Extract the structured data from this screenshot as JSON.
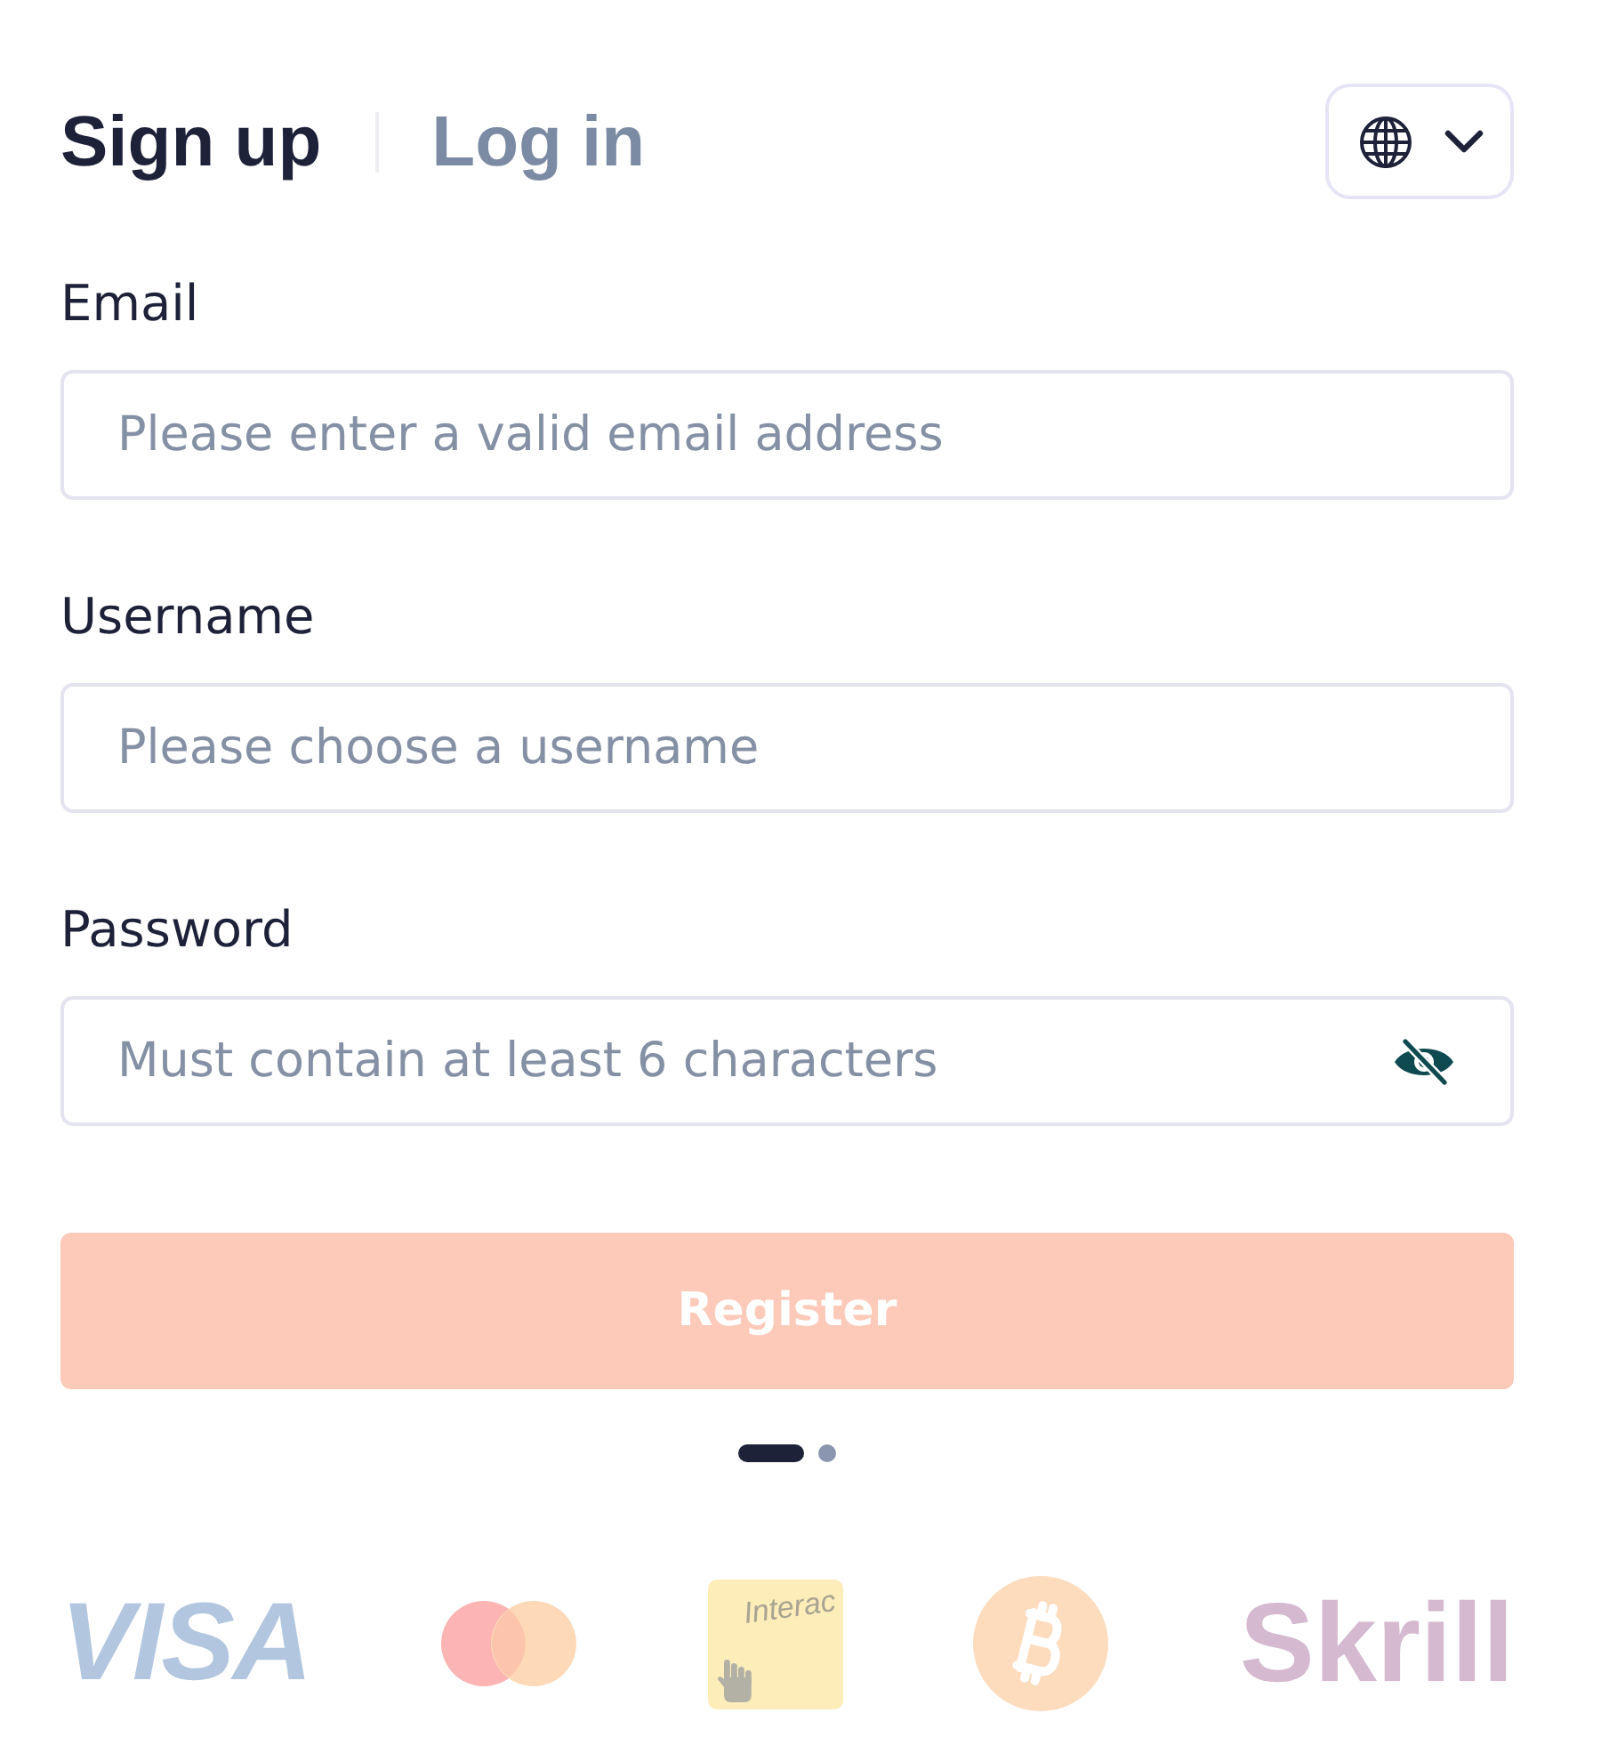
{
  "tabs": [
    {
      "label": "Sign up",
      "selected": true
    },
    {
      "label": "Log in",
      "selected": false
    }
  ],
  "language_menu": {
    "expanded": false
  },
  "fields": [
    {
      "kind": "email",
      "label": "Email",
      "placeholder": "Please enter a valid email address"
    },
    {
      "kind": "text",
      "label": "Username",
      "placeholder": "Please choose a username"
    },
    {
      "kind": "password",
      "label": "Password",
      "placeholder": "Must contain at least 6 characters"
    }
  ],
  "register_button": {
    "label": "Register",
    "disabled": true
  },
  "pager": [
    {
      "selected": true
    },
    {
      "selected": false
    }
  ],
  "payment_methods": [
    {
      "kind": "visa",
      "text": "VISA"
    },
    {
      "kind": "mastercard"
    },
    {
      "kind": "interac",
      "text": "Interac"
    },
    {
      "kind": "bitcoin"
    },
    {
      "kind": "skrill",
      "text": "Skrill"
    }
  ]
}
